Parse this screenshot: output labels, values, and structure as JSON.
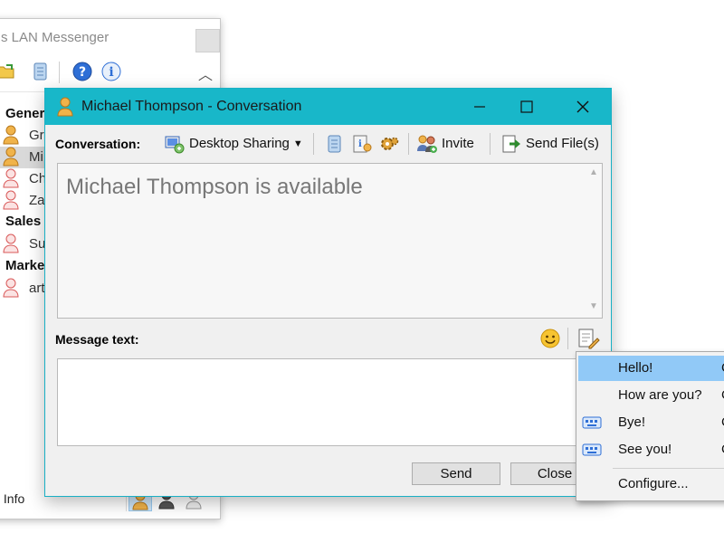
{
  "main_window": {
    "title": "s LAN Messenger",
    "groups": [
      {
        "name": "Gener",
        "contacts": [
          {
            "name": "Gr",
            "status": "available"
          },
          {
            "name": "Mi",
            "status": "available",
            "selected": true
          },
          {
            "name": "Ch",
            "status": "offline"
          },
          {
            "name": "Za",
            "status": "offline"
          }
        ]
      },
      {
        "name": "Sales",
        "contacts": [
          {
            "name": "Su",
            "status": "offline"
          }
        ]
      },
      {
        "name": "Marke",
        "contacts": [
          {
            "name": "art",
            "status": "offline"
          }
        ]
      }
    ],
    "footer_label": "y Info"
  },
  "conversation": {
    "title": "Michael Thompson - Conversation",
    "toolbar": {
      "label": "Conversation:",
      "desktop_sharing": "Desktop Sharing",
      "invite": "Invite",
      "send_files": "Send File(s)"
    },
    "history_text": "Michael Thompson is available",
    "message_label": "Message text:",
    "message_value": "",
    "buttons": {
      "send": "Send",
      "close": "Close"
    }
  },
  "quick_menu": {
    "items": [
      {
        "label": "Hello!",
        "tail": "C",
        "highlighted": true,
        "icon": ""
      },
      {
        "label": "How are you?",
        "tail": "C",
        "icon": ""
      },
      {
        "label": "Bye!",
        "tail": "C",
        "icon": "keyboard-icon"
      },
      {
        "label": "See you!",
        "tail": "C",
        "icon": "keyboard-icon"
      }
    ],
    "configure": "Configure..."
  },
  "colors": {
    "titlebar": "#18b7c9",
    "menu_highlight": "#91c9f7",
    "available": "#e39b2e",
    "offline": "#e06a6a"
  }
}
